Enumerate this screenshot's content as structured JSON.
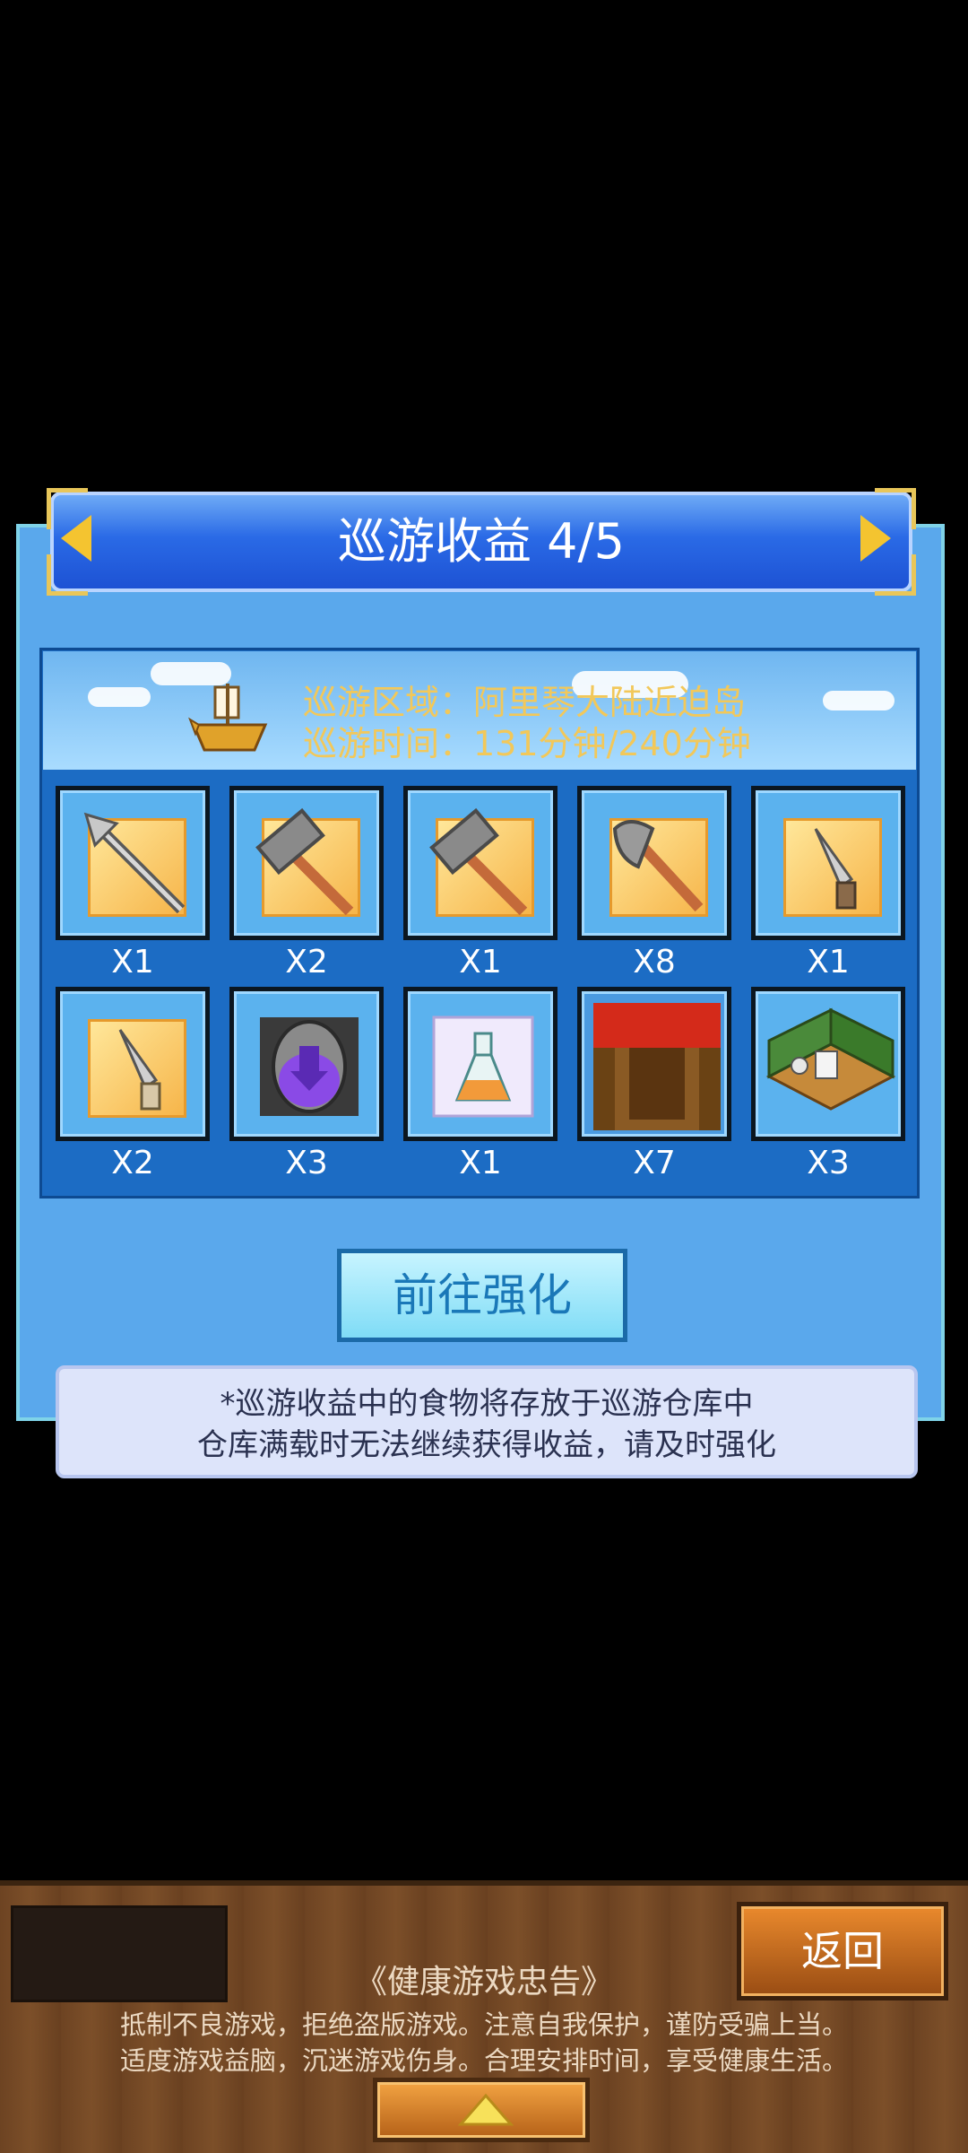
{
  "dialog": {
    "title": "巡游收益 4/5",
    "info": {
      "region_label": "巡游区域：阿里琴大陆近迫岛",
      "time_label": "巡游时间：131分钟/240分钟"
    },
    "items": [
      {
        "icon": "spear-icon",
        "qty": "X1"
      },
      {
        "icon": "hammer-icon",
        "qty": "X2"
      },
      {
        "icon": "hammer-icon",
        "qty": "X1"
      },
      {
        "icon": "axe-icon",
        "qty": "X8"
      },
      {
        "icon": "dagger-icon",
        "qty": "X1"
      },
      {
        "icon": "dagger-icon",
        "qty": "X2"
      },
      {
        "icon": "purple-egg-icon",
        "qty": "X3"
      },
      {
        "icon": "potion-flask-icon",
        "qty": "X1"
      },
      {
        "icon": "brown-block-icon",
        "qty": "X7"
      },
      {
        "icon": "room-furniture-icon",
        "qty": "X3"
      }
    ],
    "upgrade_button": "前往强化",
    "note_line1": "*巡游收益中的食物将存放于巡游仓库中",
    "note_line2": "仓库满载时无法继续获得收益，请及时强化"
  },
  "bottom_bar": {
    "back_button": "返回",
    "notice_title": "《健康游戏忠告》",
    "notice_line1": "抵制不良游戏，拒绝盗版游戏。注意自我保护，谨防受骗上当。",
    "notice_line2": "适度游戏益脑，沉迷游戏伤身。合理安排时间，享受健康生活。"
  },
  "colors": {
    "dialog_bg": "#5aa8ec",
    "title_blue": "#2a6ae6",
    "info_text": "#f2c85a",
    "slot_gold": "#f6b54a",
    "wood": "#7c4f29"
  }
}
